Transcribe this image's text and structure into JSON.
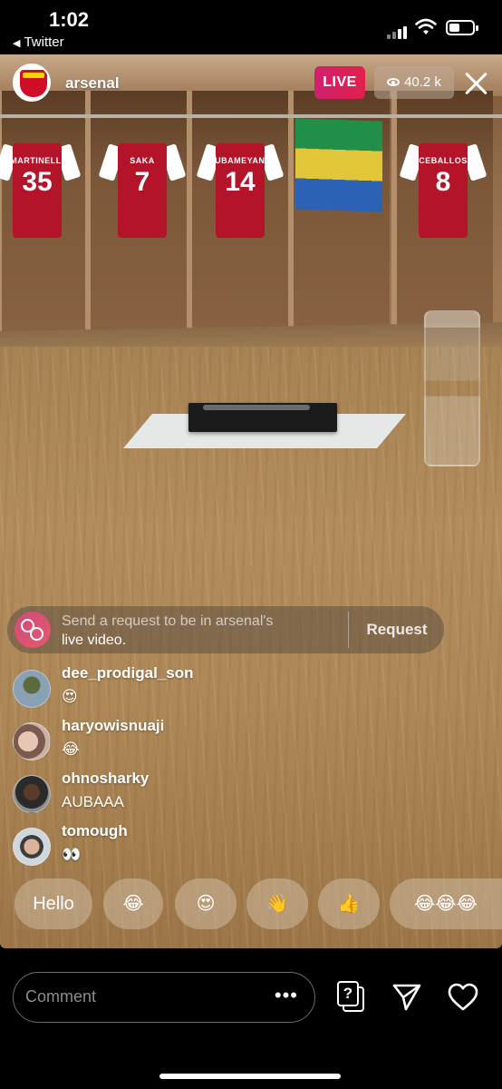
{
  "status_bar": {
    "time": "1:02",
    "back_app": "Twitter"
  },
  "header": {
    "username": "arsenal",
    "live_label": "LIVE",
    "viewer_count": "40.2 k"
  },
  "scene": {
    "jerseys": [
      {
        "name": "MARTINELLI",
        "number": "35"
      },
      {
        "name": "SAKA",
        "number": "7"
      },
      {
        "name": "AUBAMEYANG",
        "number": "14"
      },
      {
        "name": "CEBALLOS",
        "number": "8"
      }
    ]
  },
  "request": {
    "text_line1": "Send a request to be in arsenal's",
    "text_line2": "live video.",
    "button_label": "Request"
  },
  "comments": [
    {
      "user": "dee_prodigal_son",
      "text": "😍"
    },
    {
      "user": "haryowisnuaji",
      "text": "😂"
    },
    {
      "user": "ohnosharky",
      "text": "AUBAAA"
    },
    {
      "user": "tomough",
      "text": "👀"
    }
  ],
  "quick_reactions": [
    "Hello",
    "😂",
    "😍",
    "👋",
    "👍",
    "😂😂😂"
  ],
  "bottom_bar": {
    "comment_placeholder": "Comment",
    "more_label": "•••",
    "question_glyph": "?"
  },
  "colors": {
    "live_gradient_start": "#d0216f",
    "live_gradient_end": "#e2204a",
    "arsenal_red": "#d00d26"
  },
  "icons": [
    "close-icon",
    "eye-icon",
    "question-box-icon",
    "send-icon",
    "heart-icon"
  ]
}
